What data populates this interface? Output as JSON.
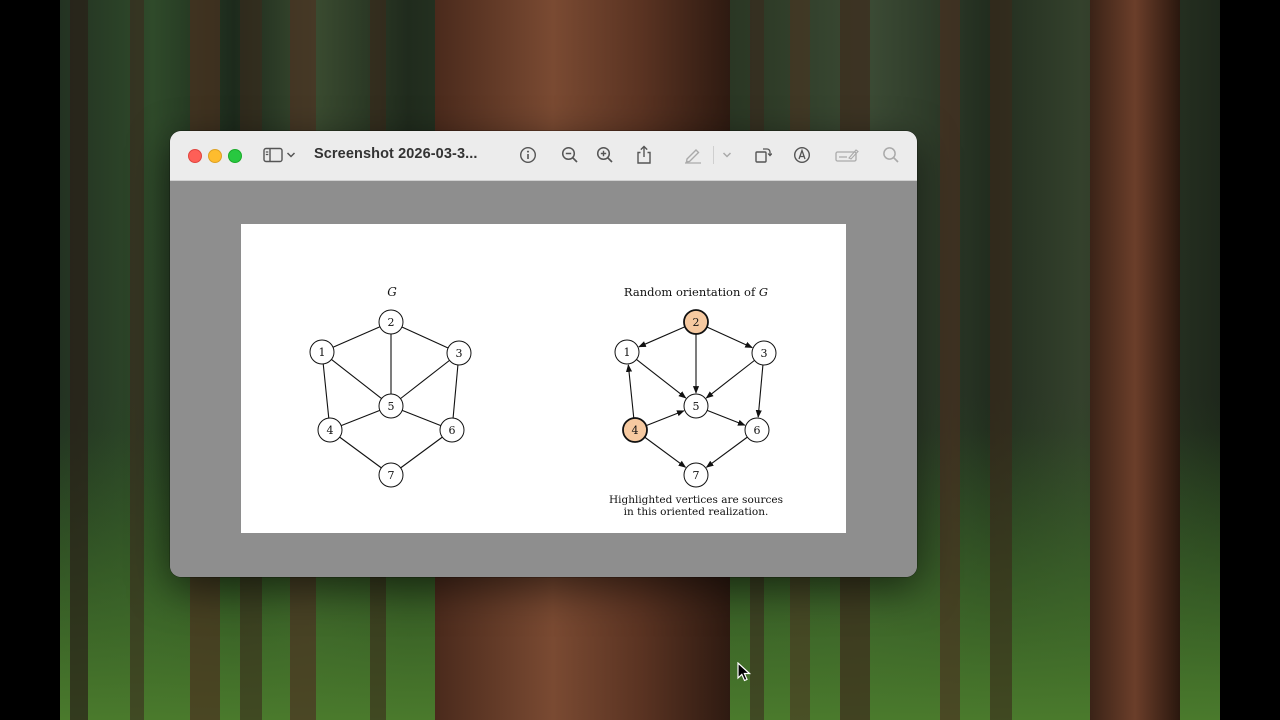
{
  "window": {
    "title": "Screenshot 2026-03-3...",
    "toolbar_icons": [
      "sidebar-icon",
      "chevron-down-icon",
      "info-icon",
      "zoom-out-icon",
      "zoom-in-icon",
      "share-icon",
      "markup-pen-icon",
      "chevron-down-icon",
      "rotate-icon",
      "markup-circle-icon",
      "form-fill-icon",
      "search-icon"
    ]
  },
  "document": {
    "left_graph": {
      "title": "G",
      "vertices": [
        {
          "id": "1",
          "highlighted": false
        },
        {
          "id": "2",
          "highlighted": false
        },
        {
          "id": "3",
          "highlighted": false
        },
        {
          "id": "4",
          "highlighted": false
        },
        {
          "id": "5",
          "highlighted": false
        },
        {
          "id": "6",
          "highlighted": false
        },
        {
          "id": "7",
          "highlighted": false
        }
      ],
      "edges": [
        [
          "1",
          "2"
        ],
        [
          "2",
          "3"
        ],
        [
          "2",
          "5"
        ],
        [
          "1",
          "5"
        ],
        [
          "3",
          "5"
        ],
        [
          "1",
          "4"
        ],
        [
          "3",
          "6"
        ],
        [
          "4",
          "5"
        ],
        [
          "5",
          "6"
        ],
        [
          "4",
          "7"
        ],
        [
          "6",
          "7"
        ]
      ]
    },
    "right_graph": {
      "title_prefix": "Random orientation of ",
      "title_var": "G",
      "vertices": [
        {
          "id": "1",
          "highlighted": false
        },
        {
          "id": "2",
          "highlighted": true
        },
        {
          "id": "3",
          "highlighted": false
        },
        {
          "id": "4",
          "highlighted": true
        },
        {
          "id": "5",
          "highlighted": false
        },
        {
          "id": "6",
          "highlighted": false
        },
        {
          "id": "7",
          "highlighted": false
        }
      ],
      "arcs": [
        [
          "2",
          "1"
        ],
        [
          "2",
          "3"
        ],
        [
          "2",
          "5"
        ],
        [
          "1",
          "5"
        ],
        [
          "3",
          "5"
        ],
        [
          "4",
          "1"
        ],
        [
          "3",
          "6"
        ],
        [
          "4",
          "5"
        ],
        [
          "5",
          "6"
        ],
        [
          "4",
          "7"
        ],
        [
          "6",
          "7"
        ]
      ],
      "caption_line1": "Highlighted vertices are sources",
      "caption_line2": "in this oriented realization."
    },
    "colors": {
      "highlight_fill": "#f6c9a0",
      "stroke": "#111111"
    }
  }
}
